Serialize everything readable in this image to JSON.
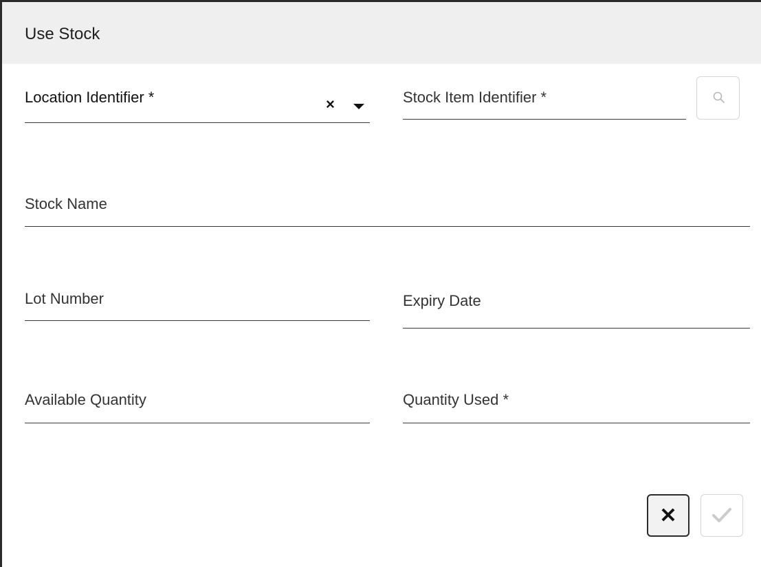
{
  "dialog": {
    "title": "Use Stock"
  },
  "fields": {
    "location_identifier": {
      "label": "Location Identifier *",
      "clear_glyph": "×"
    },
    "stock_item_identifier": {
      "label": "Stock Item Identifier *"
    },
    "stock_name": {
      "label": "Stock Name"
    },
    "lot_number": {
      "label": "Lot Number"
    },
    "expiry_date": {
      "label": "Expiry Date"
    },
    "available_quantity": {
      "label": "Available Quantity"
    },
    "quantity_used": {
      "label": "Quantity Used *"
    }
  },
  "buttons": {
    "search": {
      "icon": "search-icon"
    },
    "cancel": {
      "icon": "close-icon",
      "glyph": "✕"
    },
    "confirm": {
      "icon": "check-icon"
    }
  },
  "colors": {
    "title_bar": "#efefef",
    "text": "#333333",
    "border": "#2b2b2b",
    "disabled": "#cccccc"
  }
}
